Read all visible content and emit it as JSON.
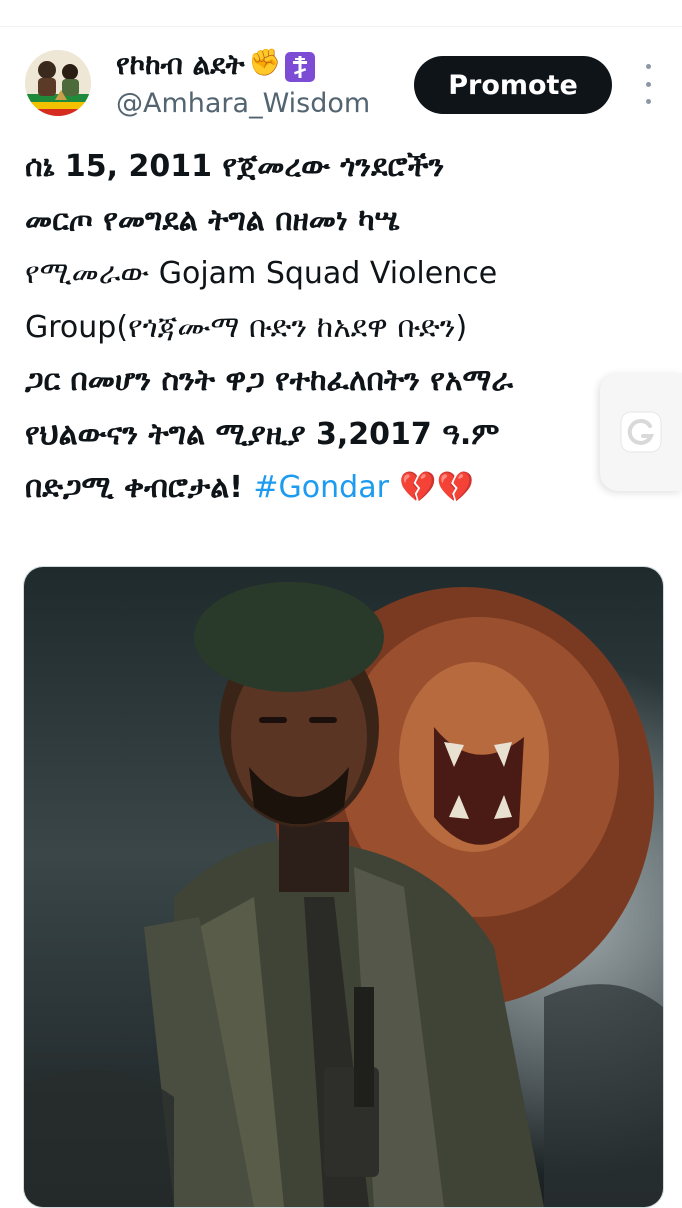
{
  "tweet": {
    "display_name": "የኮከብ ልደት",
    "handle": "@Amhara_Wisdom",
    "promote_label": "Promote",
    "body_lines": [
      "ሰኔ 15, 2011 የጀመረው ጎንደሮችን",
      "መርጦ የመግደል ትግል በዘመነ ካሤ",
      "የሚመራው Gojam Squad Violence",
      "Group(የጎጃሙማ ቡድን  ከአደዋ ቡድን)",
      "ጋር በመሆን ስንት ዋጋ የተከፈለበትን የአማራ",
      "የህልውናን ትግል ሚያዚያ 3,2017 ዓ.ም",
      "በድጋሚ ቀብሮታል!"
    ],
    "hashtag": "#Gondar",
    "trailing_emoji": "💔💔"
  },
  "icons": {
    "avatar": "avatar-image",
    "name_emoji": [
      "raised-fist-icon",
      "orthodox-cross-icon"
    ],
    "more": "more-options-icon",
    "side_widget": "grammarly-widget-icon"
  },
  "colors": {
    "accent": "#1d9bf0",
    "text": "#0f1419",
    "secondary_text": "#536471",
    "button_bg": "#0f1419",
    "badge_purple": "#7c4dd4"
  }
}
